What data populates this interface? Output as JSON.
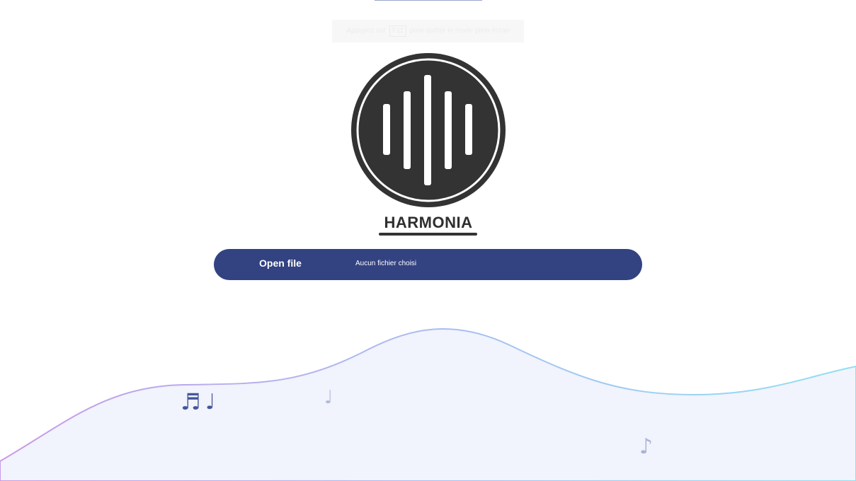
{
  "header": {
    "notice_before": "Appuyez sur",
    "notice_key": "F11",
    "notice_after": "pour quitter le mode plein écran"
  },
  "brand": {
    "name": "HARMONIA"
  },
  "file_input": {
    "button_label": "Open file",
    "status": "Aucun fichier choisi"
  },
  "decor": {
    "notes": [
      "♬",
      "♩",
      "♩",
      "♪"
    ]
  },
  "colors": {
    "accent": "#334281",
    "logo": "#333333",
    "wave_start": "#c89be6",
    "wave_end": "#8fe0f2",
    "wave_fill": "#f1f3fd"
  }
}
